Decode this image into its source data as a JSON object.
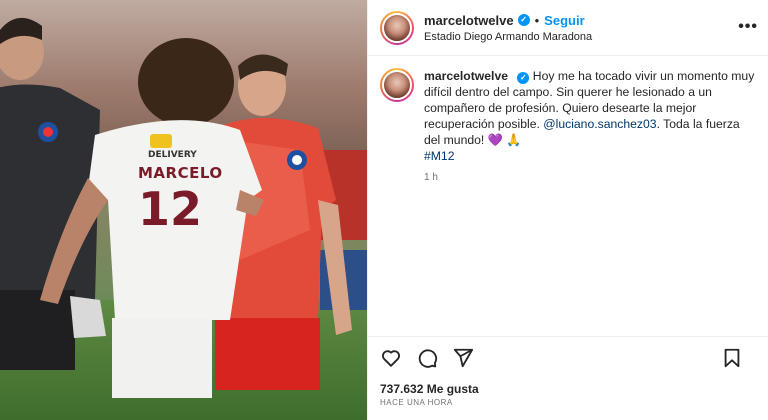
{
  "photo": {
    "alt_icon": "photo",
    "shirt_sponsor": "DELIVERY",
    "shirt_name": "MARCELO",
    "shirt_number": "12"
  },
  "post": {
    "username": "marcelotwelve",
    "verified_icon": "verified-badge-icon",
    "separator": "•",
    "follow_label": "Seguir",
    "location": "Estadio Diego Armando Maradona",
    "more_label": "•••",
    "caption": {
      "username": "marcelotwelve",
      "text_1": "Hoy me ha tocado vivir un momento muy difícil dentro del campo. Sin querer he lesionado a un compañero de profesión. Quiero desearte la mejor recuperación posible.",
      "mention": "@luciano.sanchez03",
      "text_2": ". Toda la fuerza del mundo!",
      "emoji": "💜 🙏",
      "hashtag": "#M12",
      "time_ago": "1 h"
    },
    "likes": "737.632 Me gusta",
    "posted": "HACE UNA HORA"
  },
  "colors": {
    "accent": "#0095f6",
    "link": "#00376b",
    "muted": "#737373"
  }
}
